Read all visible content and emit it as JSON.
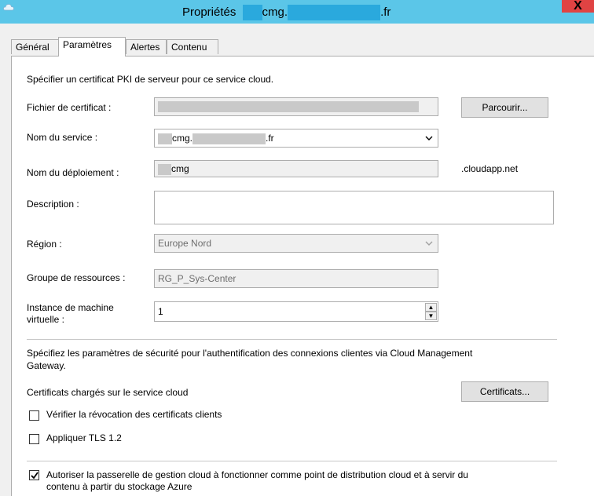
{
  "window": {
    "title_prefix": "Propriétés",
    "title_mid": "cmg.",
    "title_suffix": ".fr",
    "close_glyph": "X"
  },
  "tabs": [
    {
      "label": "Général"
    },
    {
      "label": "Paramètres"
    },
    {
      "label": "Alertes"
    },
    {
      "label": "Contenu"
    }
  ],
  "form": {
    "intro": "Spécifier un certificat PKI de serveur pour ce service cloud.",
    "cert_file_label": "Fichier de certificat :",
    "browse_button": "Parcourir...",
    "service_name_label": "Nom du service :",
    "service_name_mid": "cmg.",
    "service_name_suffix": ".fr",
    "deployment_label": "Nom du déploiement :",
    "deployment_value": "cmg",
    "deployment_suffix": ".cloudapp.net",
    "description_label": "Description :",
    "description_value": "",
    "region_label": "Région :",
    "region_value": "Europe Nord",
    "resource_group_label": "Groupe de ressources :",
    "resource_group_value": "RG_P_Sys-Center",
    "vm_instance_label_1": "Instance de machine",
    "vm_instance_label_2": "virtuelle :",
    "vm_instance_value": "1"
  },
  "security": {
    "intro_line1": "Spécifiez les paramètres de sécurité pour l'authentification des connexions clientes via Cloud Management",
    "intro_line2": "Gateway.",
    "certs_label": "Certificats chargés sur le service cloud",
    "certs_button": "Certificats...",
    "checkbox_revocation": "Vérifier la révocation des certificats clients",
    "checkbox_tls": "Appliquer TLS 1.2",
    "checkbox_distribution_line1": "Autoriser la passerelle de gestion cloud à fonctionner comme point de distribution cloud et à servir du",
    "checkbox_distribution_line2": "contenu à partir du stockage Azure"
  },
  "checkbox_states": {
    "revocation": false,
    "tls": false,
    "distribution": true
  }
}
